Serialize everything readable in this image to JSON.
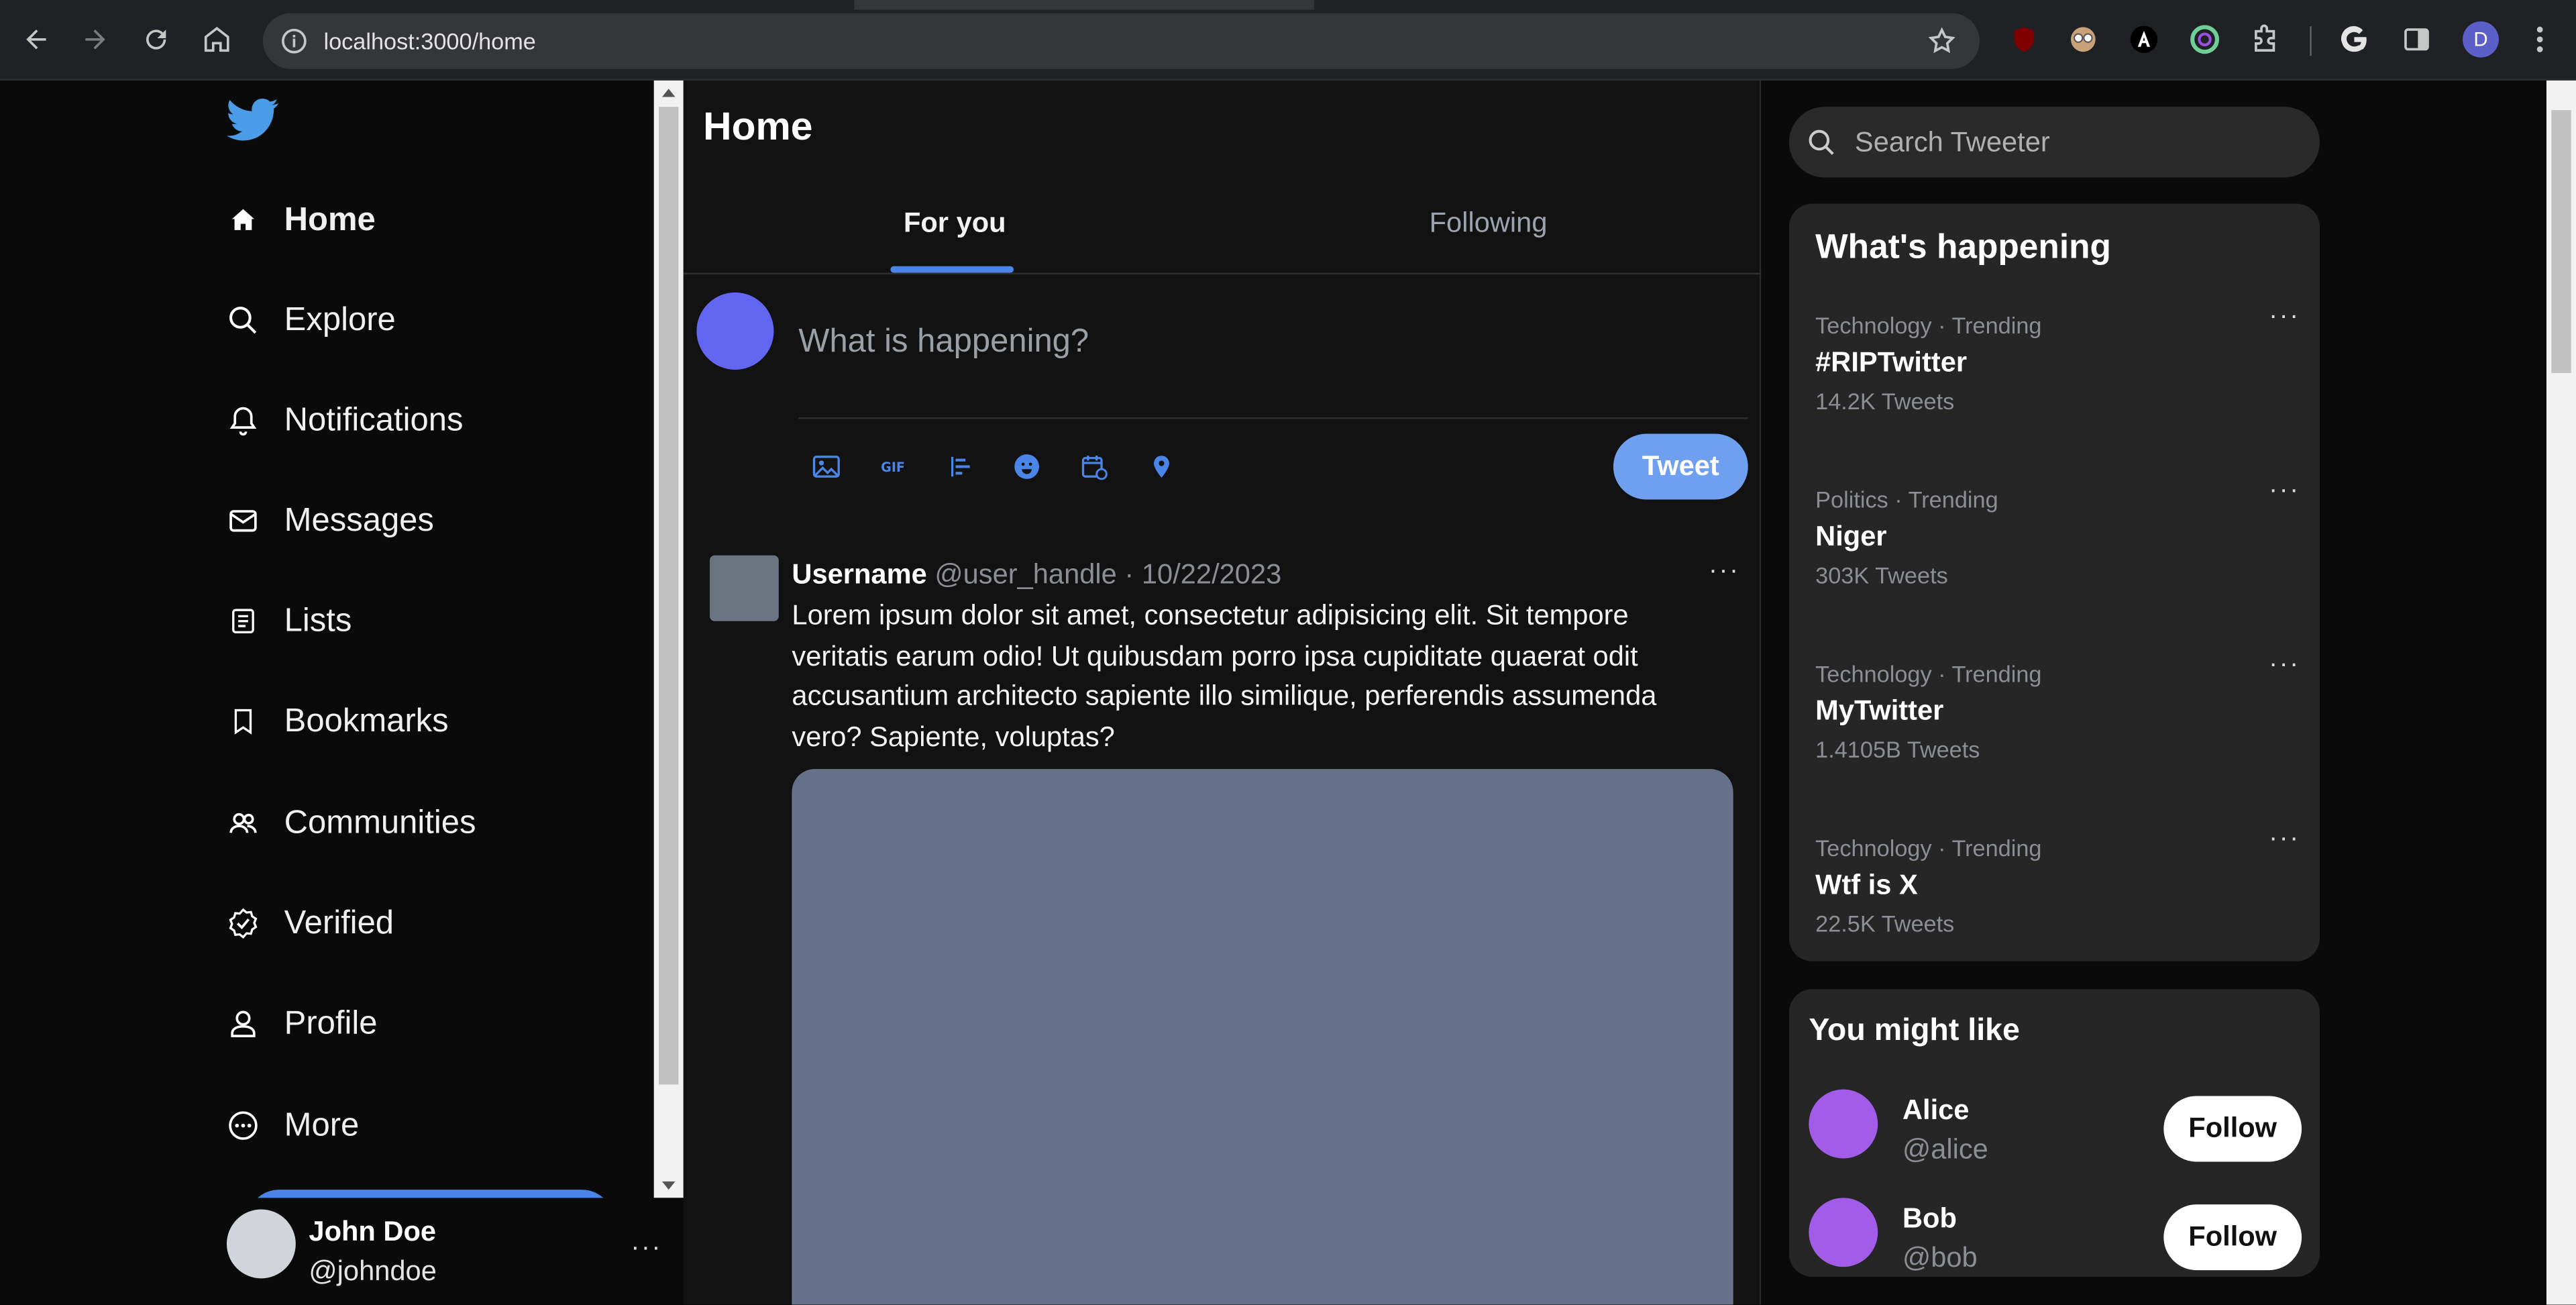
{
  "browser": {
    "url": "localhost:3000/home",
    "profile_initial": "D"
  },
  "leftnav": {
    "items": [
      {
        "label": "Home",
        "icon": "home-icon"
      },
      {
        "label": "Explore",
        "icon": "search-icon"
      },
      {
        "label": "Notifications",
        "icon": "bell-icon"
      },
      {
        "label": "Messages",
        "icon": "mail-icon"
      },
      {
        "label": "Lists",
        "icon": "list-icon"
      },
      {
        "label": "Bookmarks",
        "icon": "bookmark-icon"
      },
      {
        "label": "Communities",
        "icon": "people-icon"
      },
      {
        "label": "Verified",
        "icon": "verified-icon"
      },
      {
        "label": "Profile",
        "icon": "user-icon"
      },
      {
        "label": "More",
        "icon": "more-circle-icon"
      }
    ],
    "user": {
      "name": "John Doe",
      "handle": "@johndoe",
      "menu": "···"
    }
  },
  "center": {
    "title": "Home",
    "tabs": [
      {
        "label": "For you"
      },
      {
        "label": "Following"
      }
    ],
    "compose": {
      "placeholder": "What is happening?",
      "tweet_label": "Tweet"
    },
    "post": {
      "username": "Username",
      "handle": "@user_handle",
      "separator": "·",
      "date": "10/22/2023",
      "menu": "···",
      "body": "Lorem ipsum dolor sit amet, consectetur adipisicing elit. Sit tempore veritatis earum odio! Ut quibusdam porro ipsa cupiditate quaerat odit accusantium architecto sapiente illo similique, perferendis assumenda vero? Sapiente, voluptas?"
    }
  },
  "right": {
    "search_placeholder": "Search Tweeter",
    "trends_title": "What's happening",
    "trends": [
      {
        "meta": "Technology · Trending",
        "name": "#RIPTwitter",
        "count": "14.2K Tweets"
      },
      {
        "meta": "Politics · Trending",
        "name": "Niger",
        "count": "303K Tweets"
      },
      {
        "meta": "Technology · Trending",
        "name": "MyTwitter",
        "count": "1.4105B Tweets"
      },
      {
        "meta": "Technology · Trending",
        "name": "Wtf is X",
        "count": "22.5K Tweets"
      }
    ],
    "trend_menu": "···",
    "like_title": "You might like",
    "people": [
      {
        "name": "Alice",
        "handle": "@alice",
        "action": "Follow"
      },
      {
        "name": "Bob",
        "handle": "@bob",
        "action": "Follow"
      }
    ]
  },
  "colors": {
    "accent": "#4a86e8",
    "tweet_button": "#6ea0ef",
    "compose_avatar": "#6366f1",
    "suggestion_avatar": "#a35ce8",
    "media_placeholder": "#66728a"
  }
}
